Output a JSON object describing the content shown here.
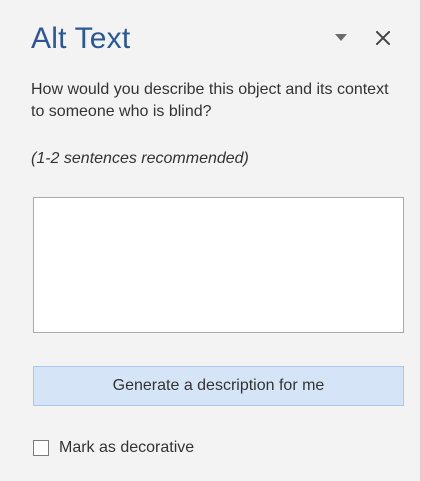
{
  "pane": {
    "title": "Alt Text",
    "accent_color": "#2b579a",
    "icons": {
      "options": "chevron-down-icon",
      "close": "close-icon"
    }
  },
  "prompt": {
    "text": "How would you describe this object and its context to someone who is blind?"
  },
  "hint": {
    "text": "(1-2 sentences recommended)"
  },
  "alt_text_input": {
    "value": "",
    "placeholder": ""
  },
  "generate_button": {
    "label": "Generate a description for me"
  },
  "decorative": {
    "label": "Mark as decorative",
    "checked": false
  }
}
